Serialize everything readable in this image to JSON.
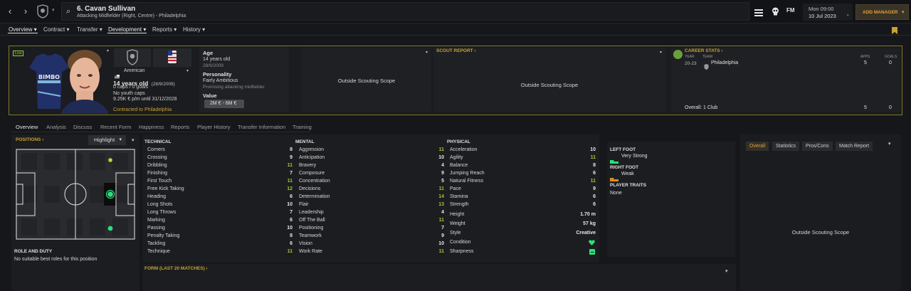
{
  "header": {
    "player_name": "6. Cavan Sullivan",
    "player_sub": "Attacking Midfielder (Right, Centre) - Philadelphia",
    "icons": [
      "chevron-left-icon",
      "chevron-right-icon",
      "club-crest-icon",
      "search-icon",
      "hamburger-menu-icon",
      "skull-icon",
      "fm-logo"
    ],
    "fm_label": "FM",
    "date_day": "Mon 09:00",
    "date_full": "10 Jul 2023",
    "add_manager": "ADD MANAGER"
  },
  "menu": [
    {
      "label": "Overview"
    },
    {
      "label": "Contract"
    },
    {
      "label": "Transfer"
    },
    {
      "label": "Development"
    },
    {
      "label": "Reports"
    },
    {
      "label": "History"
    }
  ],
  "card": {
    "badge": "Loa",
    "nationality": "American",
    "age_main": "14 years old",
    "dob": "(28/9/2009)",
    "caps": "0 caps / 0 goals",
    "youth_caps": "No youth caps",
    "wage": "9.25K € p/m until 31/12/2028",
    "contracted": "Contracted to Philadelphia",
    "age_label": "Age",
    "age_value": "14 years old",
    "age_dob": "28/9/2009",
    "personality_label": "Personality",
    "personality_value": "Fairly Ambitious",
    "personality_desc": "Promising attacking midfielder",
    "value_label": "Value",
    "value_range": "2M € - 6M €",
    "scout_left": "Outside Scouting Scope",
    "scout_report_label": "SCOUT REPORT",
    "scout_mid": "Outside Scouting Scope",
    "career_label": "CAREER STATS",
    "career_cols": [
      "YEAR",
      "TEAM",
      "APPS",
      "GOALS"
    ],
    "career_row": {
      "year": "20-23",
      "team": "Philadelphia",
      "apps": "5",
      "goals": "0"
    },
    "overall_label": "Overall: 1 Club",
    "overall_apps": "5",
    "overall_goals": "0"
  },
  "tabs": [
    "Overview",
    "Analysis",
    "Discuss",
    "Recent Form",
    "Happiness",
    "Reports",
    "Player History",
    "Transfer Information",
    "Training"
  ],
  "positions": {
    "label": "POSITIONS",
    "highlight": "Highlight",
    "role_title": "ROLE AND DUTY",
    "role_text": "No suitable best roles for this position"
  },
  "technical": {
    "title": "TECHNICAL",
    "attrs": [
      {
        "name": "Corners",
        "value": "8"
      },
      {
        "name": "Crossing",
        "value": "9"
      },
      {
        "name": "Dribbling",
        "value": "11"
      },
      {
        "name": "Finishing",
        "value": "7"
      },
      {
        "name": "First Touch",
        "value": "11"
      },
      {
        "name": "Free Kick Taking",
        "value": "12"
      },
      {
        "name": "Heading",
        "value": "6"
      },
      {
        "name": "Long Shots",
        "value": "10"
      },
      {
        "name": "Long Throws",
        "value": "7"
      },
      {
        "name": "Marking",
        "value": "6"
      },
      {
        "name": "Passing",
        "value": "10"
      },
      {
        "name": "Penalty Taking",
        "value": "8"
      },
      {
        "name": "Tackling",
        "value": "6"
      },
      {
        "name": "Technique",
        "value": "11"
      }
    ]
  },
  "mental": {
    "title": "MENTAL",
    "attrs": [
      {
        "name": "Aggression",
        "value": "11"
      },
      {
        "name": "Anticipation",
        "value": "10"
      },
      {
        "name": "Bravery",
        "value": "4"
      },
      {
        "name": "Composure",
        "value": "9"
      },
      {
        "name": "Concentration",
        "value": "5"
      },
      {
        "name": "Decisions",
        "value": "11"
      },
      {
        "name": "Determination",
        "value": "14"
      },
      {
        "name": "Flair",
        "value": "13"
      },
      {
        "name": "Leadership",
        "value": "4"
      },
      {
        "name": "Off The Ball",
        "value": "11"
      },
      {
        "name": "Positioning",
        "value": "7"
      },
      {
        "name": "Teamwork",
        "value": "9"
      },
      {
        "name": "Vision",
        "value": "10"
      },
      {
        "name": "Work Rate",
        "value": "11"
      }
    ]
  },
  "physical": {
    "title": "PHYSICAL",
    "attrs": [
      {
        "name": "Acceleration",
        "value": "10"
      },
      {
        "name": "Agility",
        "value": "11"
      },
      {
        "name": "Balance",
        "value": "8"
      },
      {
        "name": "Jumping Reach",
        "value": "6"
      },
      {
        "name": "Natural Fitness",
        "value": "11"
      },
      {
        "name": "Pace",
        "value": "9"
      },
      {
        "name": "Stamina",
        "value": "6"
      },
      {
        "name": "Strength",
        "value": "6"
      }
    ],
    "height_label": "Height",
    "height_value": "1.70 m",
    "weight_label": "Weight",
    "weight_value": "57 kg",
    "style_label": "Style",
    "style_value": "Creative",
    "condition_label": "Condition",
    "sharpness_label": "Sharpness"
  },
  "form": {
    "label": "FORM (LAST 20 MATCHES)"
  },
  "feet": {
    "left_title": "LEFT FOOT",
    "left_value": "Very Strong",
    "right_title": "RIGHT FOOT",
    "right_value": "Weak",
    "traits_title": "PLAYER TRAITS",
    "traits_value": "None"
  },
  "right_panel": {
    "buttons": [
      "Overall",
      "Statistics",
      "Pros/Cons",
      "Match Report"
    ],
    "scope_text": "Outside Scouting Scope"
  },
  "colors": {
    "accent": "#c9a230",
    "green": "#9ec43a",
    "orange": "#e08a1e",
    "selected_border": "#7d7a2a"
  }
}
